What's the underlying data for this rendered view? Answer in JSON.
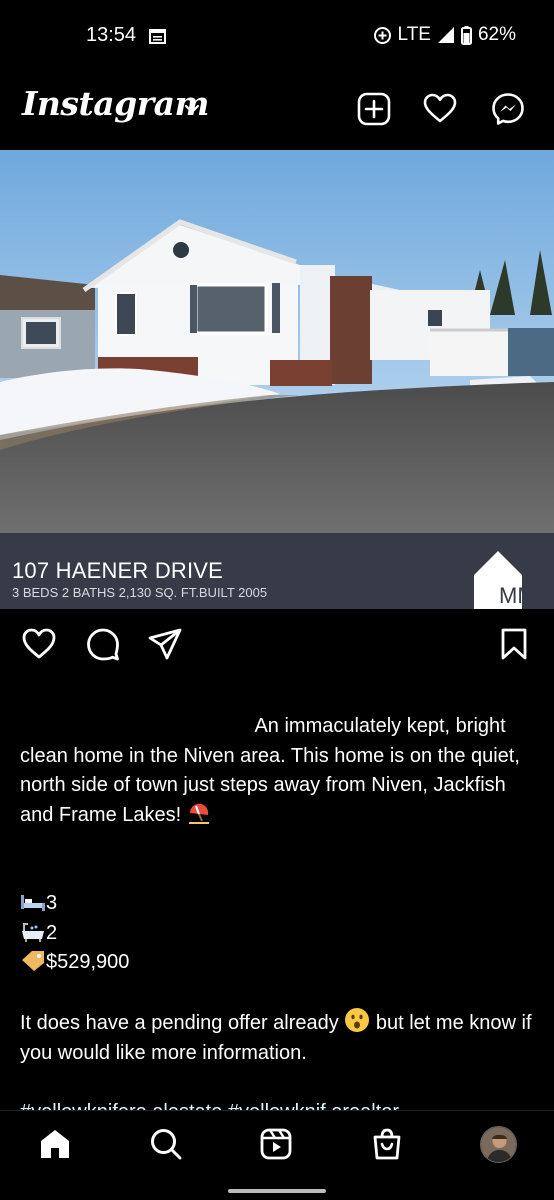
{
  "status_bar": {
    "time": "13:54",
    "network": "LTE",
    "battery": "62%",
    "icons": [
      "calendar-icon",
      "data-saver-icon",
      "signal-icon",
      "battery-icon"
    ]
  },
  "header": {
    "logo": "Instagram",
    "icons": [
      "chevron-down-icon",
      "new-post-icon",
      "heart-icon",
      "messenger-icon"
    ]
  },
  "post": {
    "image": {
      "banner_title": "107 HAENER DRIVE",
      "banner_subtitle": "3 BEDS 2 BATHS 2,130 SQ. FT.BUILT 2005",
      "brand_mark": "MM"
    },
    "actions": [
      "like-icon",
      "comment-icon",
      "share-icon",
      "save-icon"
    ],
    "caption": {
      "line_first": "An immaculately kept,",
      "line_rest": "bright clean home in the Niven area. This home is on the quiet, north side of town just steps away from Niven, Jackfish and Frame Lakes!",
      "beds": "3",
      "baths": "2",
      "price": "$529,900",
      "offer_before": "It does have a pending offer already",
      "offer_after": "but let me know if you would like more information.",
      "hashtags": "#yellowknifere alestate #yellowknif erealtor"
    }
  },
  "bottom_nav": {
    "items": [
      "home-icon",
      "search-icon",
      "reels-icon",
      "shop-icon",
      "profile-avatar"
    ]
  },
  "colors": {
    "background": "#000000",
    "banner": "#363b47",
    "text": "#ffffff"
  }
}
